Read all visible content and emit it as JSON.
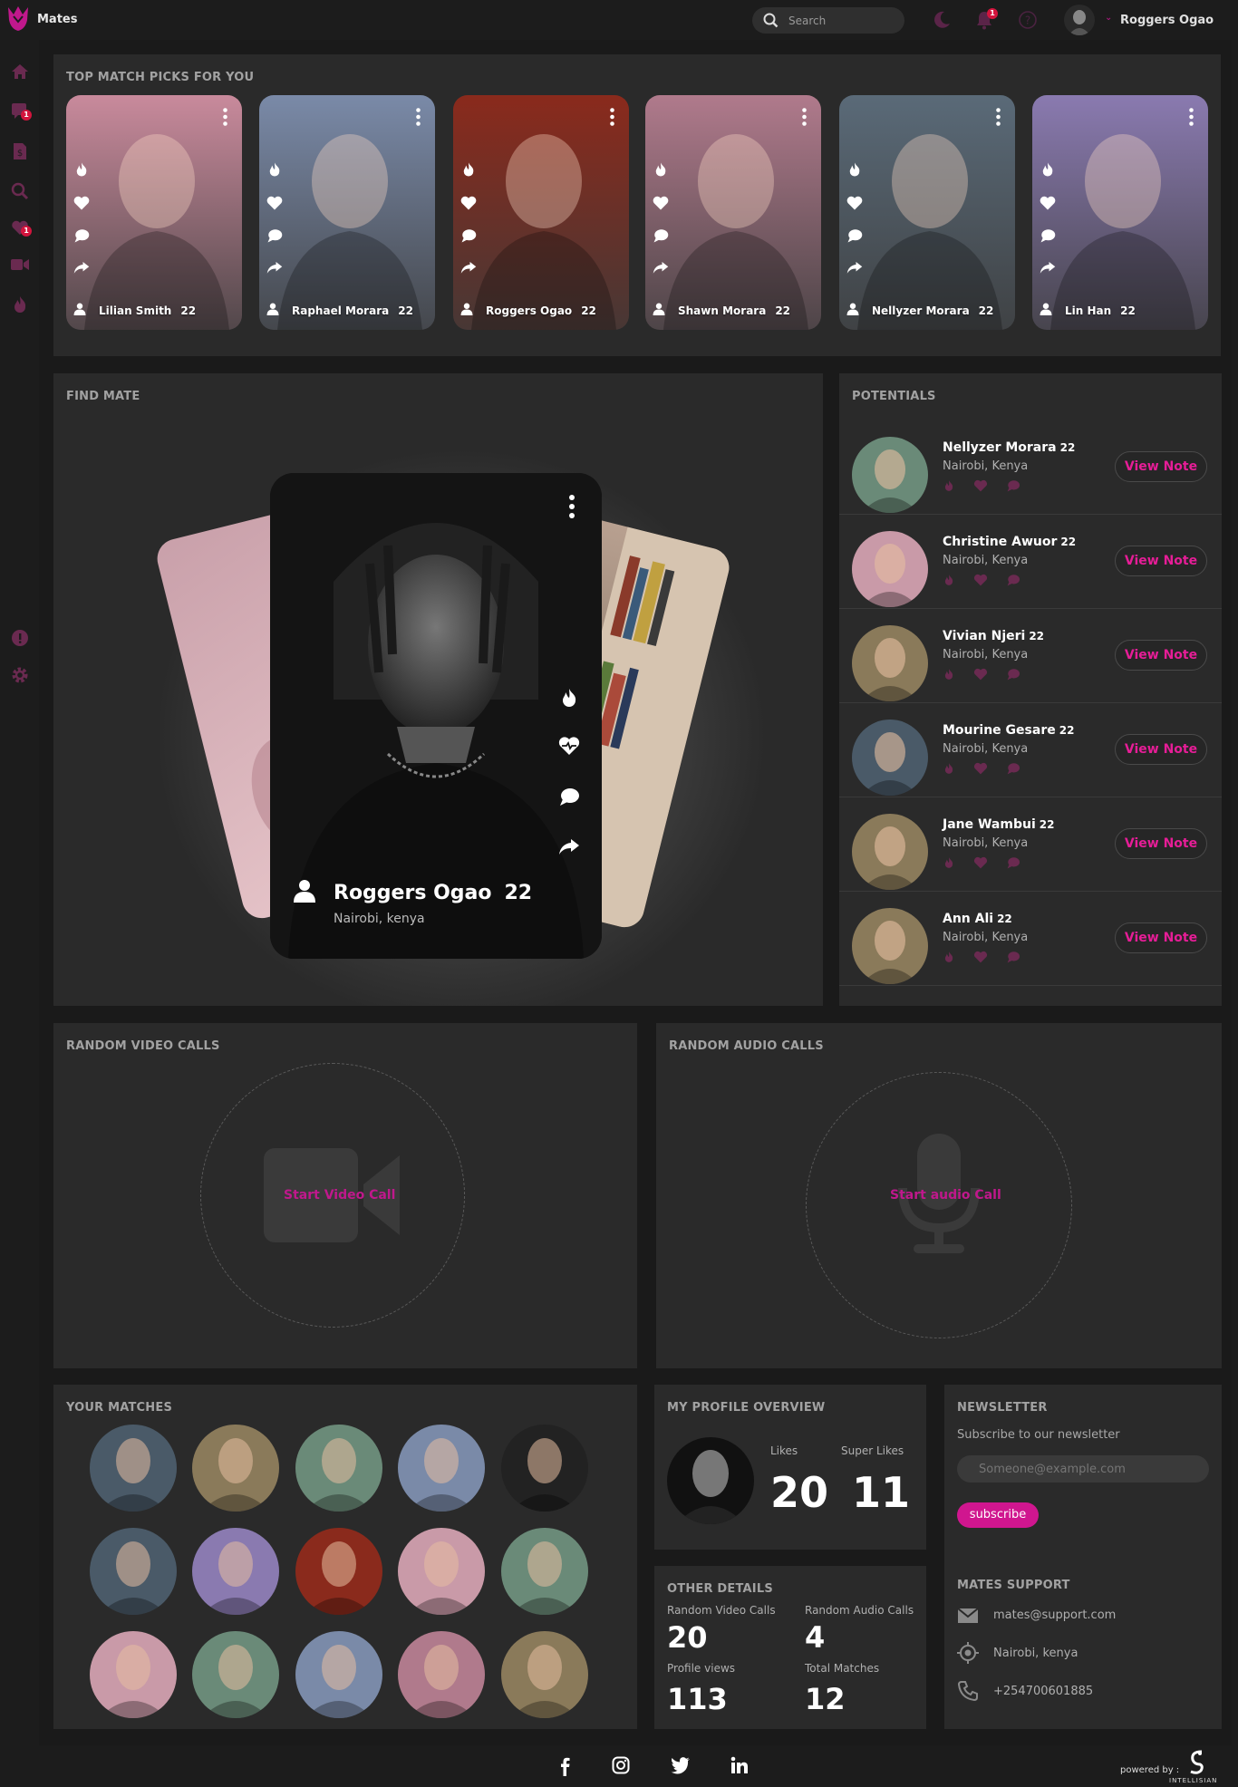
{
  "app": {
    "name": "Mates"
  },
  "search": {
    "placeholder": "Search"
  },
  "user": {
    "name": "Roggers Ogao",
    "notification_count": "1"
  },
  "sidebar": {
    "messages_badge": "1",
    "likes_badge": "1"
  },
  "top_picks": {
    "title": "TOP MATCH PICKS FOR YOU",
    "items": [
      {
        "name": "Lilian Smith",
        "age": "22",
        "bg": "#c98a9c"
      },
      {
        "name": "Raphael Morara",
        "age": "22",
        "bg": "#7a8aa8"
      },
      {
        "name": "Roggers Ogao",
        "age": "22",
        "bg": "#8a2a1c"
      },
      {
        "name": "Shawn Morara",
        "age": "22",
        "bg": "#b07a8c"
      },
      {
        "name": "Nellyzer Morara",
        "age": "22",
        "bg": "#5a6a78"
      },
      {
        "name": "Lin Han",
        "age": "22",
        "bg": "#8a7ab0"
      }
    ]
  },
  "find_mate": {
    "title": "FIND MATE",
    "card": {
      "name": "Roggers Ogao",
      "age": "22",
      "location": "Nairobi, kenya"
    }
  },
  "potentials": {
    "title": "POTENTIALS",
    "button_label": "View Note",
    "items": [
      {
        "name": "Nellyzer Morara",
        "age": "22",
        "location": "Nairobi, Kenya",
        "bg": "#6a8a78"
      },
      {
        "name": "Christine Awuor",
        "age": "22",
        "location": "Nairobi, Kenya",
        "bg": "#c99aa8"
      },
      {
        "name": "Vivian Njeri",
        "age": "22",
        "location": "Nairobi, Kenya",
        "bg": "#8a7a5a"
      },
      {
        "name": "Mourine Gesare",
        "age": "22",
        "location": "Nairobi, Kenya",
        "bg": "#4a5a68"
      },
      {
        "name": "Jane Wambui",
        "age": "22",
        "location": "Nairobi, Kenya",
        "bg": "#8a7a5a"
      },
      {
        "name": "Ann Ali",
        "age": "22",
        "location": "Nairobi, Kenya",
        "bg": "#8a7a5a"
      }
    ]
  },
  "video_calls": {
    "title": "RANDOM VIDEO CALLS",
    "action": "Start Video Call"
  },
  "audio_calls": {
    "title": "RANDOM AUDIO CALLS",
    "action": "Start audio Call"
  },
  "your_matches": {
    "title": "YOUR MATCHES",
    "colors": [
      "#4a5a68",
      "#8a7a5a",
      "#6a8a78",
      "#7a8aa8",
      "#222222",
      "#4a5a68",
      "#8a7ab0",
      "#8a2a1c",
      "#c99aa8",
      "#6a8a78",
      "#c99aa8",
      "#6a8a78",
      "#7a8aa8",
      "#b07a8c",
      "#8a7a5a"
    ]
  },
  "profile_overview": {
    "title": "MY PROFILE OVERVIEW",
    "likes_label": "Likes",
    "likes": "20",
    "super_likes_label": "Super Likes",
    "super_likes": "11"
  },
  "other_details": {
    "title": "OTHER DETAILS",
    "video_calls_label": "Random Video Calls",
    "video_calls": "20",
    "audio_calls_label": "Random Audio Calls",
    "audio_calls": "4",
    "profile_views_label": "Profile views",
    "profile_views": "113",
    "total_matches_label": "Total Matches",
    "total_matches": "12"
  },
  "newsletter": {
    "title": "NEWSLETTER",
    "subtitle": "Subscribe to our newsletter",
    "placeholder": "Someone@example.com",
    "button": "subscribe"
  },
  "support": {
    "title": "MATES SUPPORT",
    "email": "mates@support.com",
    "location": "Nairobi, kenya",
    "phone": "+254700601885"
  },
  "footer": {
    "powered_by": "powered by :",
    "brand": "INTELLISIAN"
  },
  "colors": {
    "accent": "#d0168f",
    "panel": "#2a2a2a",
    "background": "#1c1c1c"
  }
}
